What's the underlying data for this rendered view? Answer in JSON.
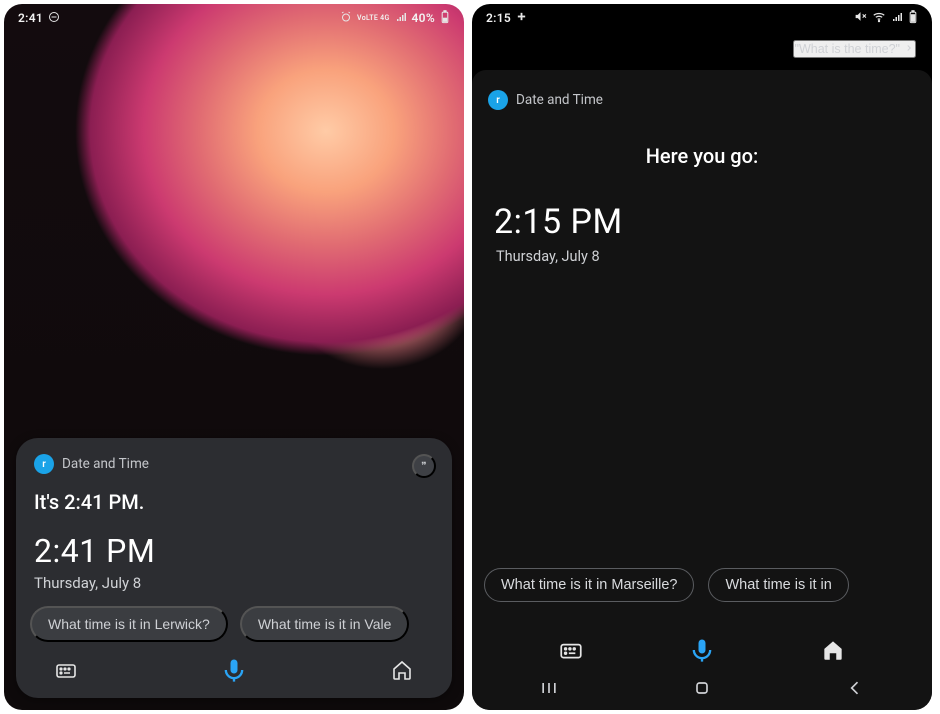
{
  "left": {
    "status": {
      "time": "2:41",
      "battery": "40%",
      "network_small": "VoLTE 4G"
    },
    "card": {
      "title": "Date and Time",
      "lead": "It's 2:41 PM.",
      "time": "2:41  PM",
      "date": "Thursday, July 8",
      "chips": [
        "What time is it in Lerwick?",
        "What time is it in Vale"
      ]
    }
  },
  "right": {
    "status": {
      "time": "2:15"
    },
    "query": "\"What is the time?\"",
    "card": {
      "title": "Date and Time",
      "lead": "Here you go:",
      "time": "2:15  PM",
      "date": "Thursday, July 8",
      "chips": [
        "What time is it in Marseille?",
        "What time is it in"
      ]
    }
  }
}
